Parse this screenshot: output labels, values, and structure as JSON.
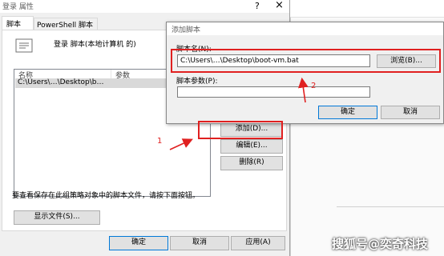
{
  "back_dialog": {
    "title": "登录 属性",
    "help": "?",
    "close": "×",
    "tabs": [
      {
        "label": "脚本"
      },
      {
        "label": "PowerShell 脚本"
      }
    ],
    "header_text": "登录 脚本(本地计算机 的)",
    "columns": [
      "名称",
      "参数"
    ],
    "row": {
      "name": "C:\\Users\\…\\Desktop\\b…"
    },
    "buttons": {
      "add": "添加(D)...",
      "edit": "编辑(E)...",
      "remove": "删除(R)"
    },
    "info_text": "要查看保存在此组策略对象中的脚本文件，请按下面按钮。",
    "show_files": "显示文件(S)...",
    "ok": "确定",
    "cancel": "取消",
    "apply": "应用(A)"
  },
  "add_dialog": {
    "title": "添加脚本",
    "name_label": "脚本名(N):",
    "name_value": "C:\\Users\\…\\Desktop\\boot-vm.bat",
    "browse": "浏览(B)...",
    "params_label": "脚本参数(P):",
    "params_value": "",
    "ok": "确定",
    "cancel": "取消"
  },
  "annotations": {
    "one": "1",
    "two": "2",
    "accent": "#e02020"
  },
  "watermark": "搜狐号@奕奇科技"
}
